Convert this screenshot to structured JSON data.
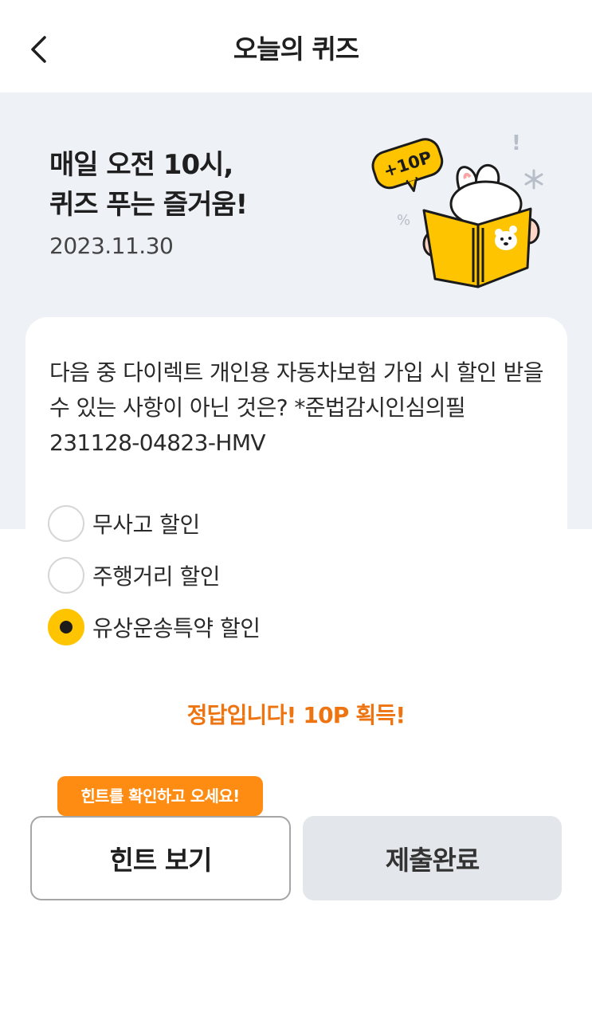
{
  "header": {
    "title": "오늘의 퀴즈",
    "back_icon": "chevron-left-icon"
  },
  "hero": {
    "title_line1": "매일 오전 10시,",
    "title_line2": "퀴즈 푸는 즐거움!",
    "date": "2023.11.30",
    "badge_text": "+10P"
  },
  "quiz": {
    "question": "다음 중 다이렉트 개인용 자동차보험 가입 시 할인 받을 수 있는 사항이 아닌 것은? *준법감시인심의필 231128-04823-HMV",
    "options": [
      {
        "label": "무사고 할인",
        "selected": false
      },
      {
        "label": "주행거리 할인",
        "selected": false
      },
      {
        "label": "유상운송특약 할인",
        "selected": true
      }
    ],
    "result": "정답입니다! 10P 획득!"
  },
  "tooltip": "힌트를 확인하고 오세요!",
  "buttons": {
    "hint_label": "힌트 보기",
    "submit_label": "제출완료"
  },
  "colors": {
    "accent": "#ffc400",
    "result_orange": "#ee7411",
    "tooltip_orange": "#ff8c12",
    "hero_bg": "#eef1f6"
  }
}
